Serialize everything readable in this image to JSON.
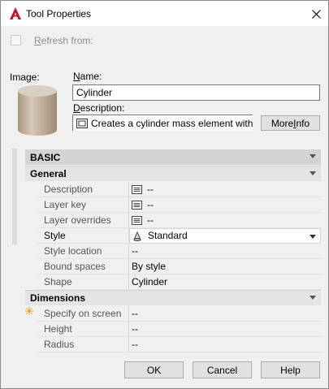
{
  "window": {
    "title": "Tool Properties"
  },
  "refresh": {
    "label": "Refresh from:",
    "checked": false
  },
  "image": {
    "label": "Image:"
  },
  "name": {
    "label": "Name:",
    "value": "Cylinder"
  },
  "description": {
    "label": "Description:",
    "value": "Creates a cylinder mass element with"
  },
  "more_info": {
    "label": "More Info"
  },
  "properties": {
    "basic": {
      "label": "BASIC"
    },
    "general": {
      "label": "General",
      "rows": [
        {
          "name": "Description",
          "value": "--",
          "icon": "list-icon"
        },
        {
          "name": "Layer key",
          "value": "--",
          "icon": "list-icon"
        },
        {
          "name": "Layer overrides",
          "value": "--",
          "icon": "list-icon"
        },
        {
          "name": "Style",
          "value": "Standard",
          "icon": "style-icon"
        },
        {
          "name": "Style location",
          "value": "--"
        },
        {
          "name": "Bound spaces",
          "value": "By style"
        },
        {
          "name": "Shape",
          "value": "Cylinder"
        }
      ]
    },
    "dimensions": {
      "label": "Dimensions",
      "rows": [
        {
          "name": "Specify on screen",
          "value": "--"
        },
        {
          "name": "Height",
          "value": "--"
        },
        {
          "name": "Radius",
          "value": "--"
        }
      ]
    }
  },
  "buttons": {
    "ok": "OK",
    "cancel": "Cancel",
    "help": "Help"
  },
  "colors": {
    "accent": "#c8102e",
    "panel": "#f0f0f0",
    "cylinder": "#c7b9a6"
  }
}
